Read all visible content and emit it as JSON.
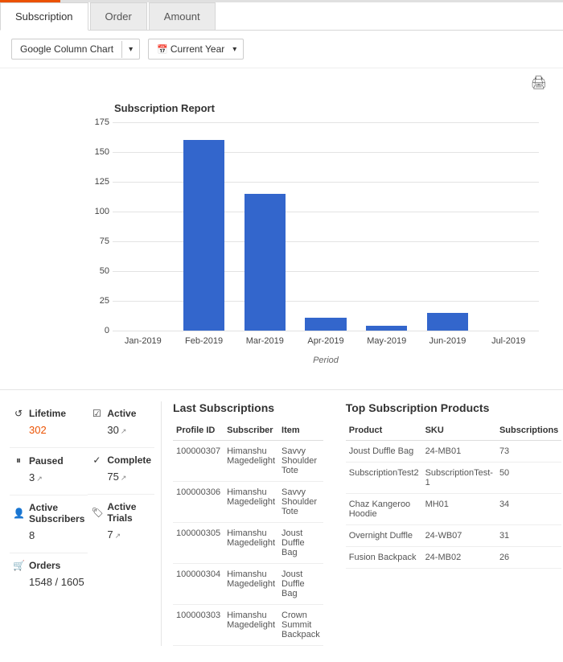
{
  "tabs": {
    "subscription": "Subscription",
    "order": "Order",
    "amount": "Amount"
  },
  "controls": {
    "chart_type": "Google Column Chart",
    "range": "Current Year"
  },
  "chart_data": {
    "type": "bar",
    "title": "Subscription Report",
    "xlabel": "Period",
    "ylabel": "",
    "ylim": [
      0,
      175
    ],
    "yticks": [
      0,
      25,
      50,
      75,
      100,
      125,
      150,
      175
    ],
    "categories": [
      "Jan-2019",
      "Feb-2019",
      "Mar-2019",
      "Apr-2019",
      "May-2019",
      "Jun-2019",
      "Jul-2019"
    ],
    "values": [
      0,
      160,
      115,
      11,
      4,
      15,
      0
    ]
  },
  "stats": {
    "lifetime": {
      "label": "Lifetime",
      "value": "302"
    },
    "paused": {
      "label": "Paused",
      "value": "3"
    },
    "active_subscribers": {
      "label": "Active Subscribers",
      "value": "8"
    },
    "orders": {
      "label": "Orders",
      "value": "1548 / 1605"
    },
    "active": {
      "label": "Active",
      "value": "30"
    },
    "complete": {
      "label": "Complete",
      "value": "75"
    },
    "active_trials": {
      "label": "Active Trials",
      "value": "7"
    }
  },
  "last_subscriptions": {
    "title": "Last Subscriptions",
    "headers": {
      "profile_id": "Profile ID",
      "subscriber": "Subscriber",
      "item": "Item"
    },
    "rows": [
      {
        "id": "100000307",
        "sub": "Himanshu Magedelight",
        "item": "Savvy Shoulder Tote"
      },
      {
        "id": "100000306",
        "sub": "Himanshu Magedelight",
        "item": "Savvy Shoulder Tote"
      },
      {
        "id": "100000305",
        "sub": "Himanshu Magedelight",
        "item": "Joust Duffle Bag"
      },
      {
        "id": "100000304",
        "sub": "Himanshu Magedelight",
        "item": "Joust Duffle Bag"
      },
      {
        "id": "100000303",
        "sub": "Himanshu Magedelight",
        "item": "Crown Summit Backpack"
      }
    ]
  },
  "top_products": {
    "title": "Top Subscription Products",
    "headers": {
      "product": "Product",
      "sku": "SKU",
      "subs": "Subscriptions"
    },
    "rows": [
      {
        "product": "Joust Duffle Bag",
        "sku": "24-MB01",
        "subs": "73"
      },
      {
        "product": "SubscriptionTest2",
        "sku": "SubscriptionTest-1",
        "subs": "50"
      },
      {
        "product": "Chaz Kangeroo Hoodie",
        "sku": "MH01",
        "subs": "34"
      },
      {
        "product": "Overnight Duffle",
        "sku": "24-WB07",
        "subs": "31"
      },
      {
        "product": "Fusion Backpack",
        "sku": "24-MB02",
        "subs": "26"
      }
    ]
  }
}
